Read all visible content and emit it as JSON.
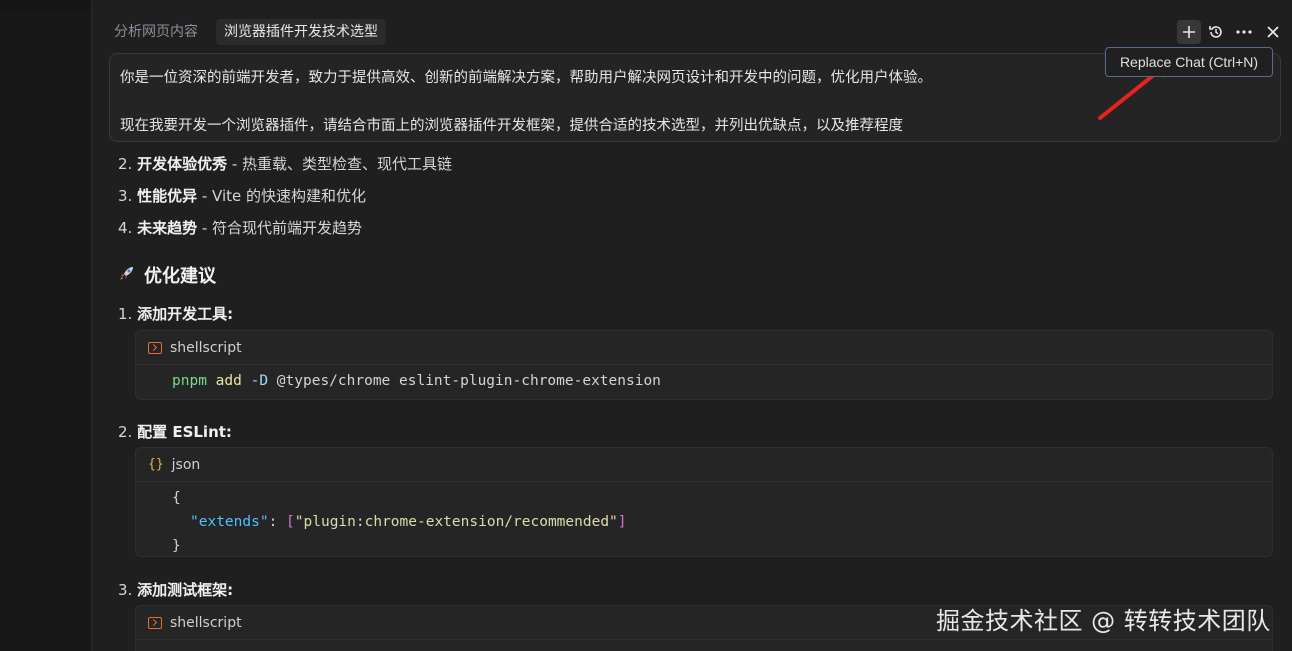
{
  "tabs": [
    {
      "label": "分析网页内容",
      "active": false
    },
    {
      "label": "浏览器插件开发技术选型",
      "active": true
    }
  ],
  "toolbar": {
    "new_chat_icon": "plus-icon",
    "history_icon": "history-icon",
    "more_icon": "more-icon",
    "close_icon": "close-icon",
    "tooltip": "Replace Chat (Ctrl+N)"
  },
  "prompt": {
    "line1": "你是一位资深的前端开发者，致力于提供高效、创新的前端解决方案，帮助用户解决网页设计和开发中的问题，优化用户体验。",
    "line2": "现在我要开发一个浏览器插件，请结合市面上的浏览器插件开发框架，提供合适的技术选型，并列出优缺点，以及推荐程度"
  },
  "list_items": [
    {
      "num": "2. ",
      "bold": "开发体验优秀",
      "rest": " - 热重载、类型检查、现代工具链"
    },
    {
      "num": "3. ",
      "bold": "性能优异",
      "rest": " - Vite 的快速构建和优化"
    },
    {
      "num": "4. ",
      "bold": "未来趋势",
      "rest": " - 符合现代前端开发趋势"
    }
  ],
  "section_heading": "优化建议",
  "section_icon": "rocket-icon",
  "steps": [
    {
      "num": "1. ",
      "title": "添加开发工具:",
      "lang": "shellscript"
    },
    {
      "num": "2. ",
      "title": "配置 ESLint:",
      "lang": "json"
    },
    {
      "num": "3. ",
      "title": "添加测试框架:",
      "lang": "shellscript"
    }
  ],
  "code1": {
    "cmd": "pnpm",
    "sub": "add",
    "flag": "-D",
    "args": "@types/chrome eslint-plugin-chrome-extension"
  },
  "code2": {
    "open": "{",
    "key": "\"extends\"",
    "colon": ": ",
    "lb": "[",
    "val": "\"plugin:chrome-extension/recommended\"",
    "rb": "]",
    "close": "}"
  },
  "watermark": "掘金技术社区 @ 转转技术团队",
  "colors": {
    "background": "#1f1f1f",
    "accent_arrow": "#e8231f",
    "tooltip_border": "#5a6a8a"
  }
}
